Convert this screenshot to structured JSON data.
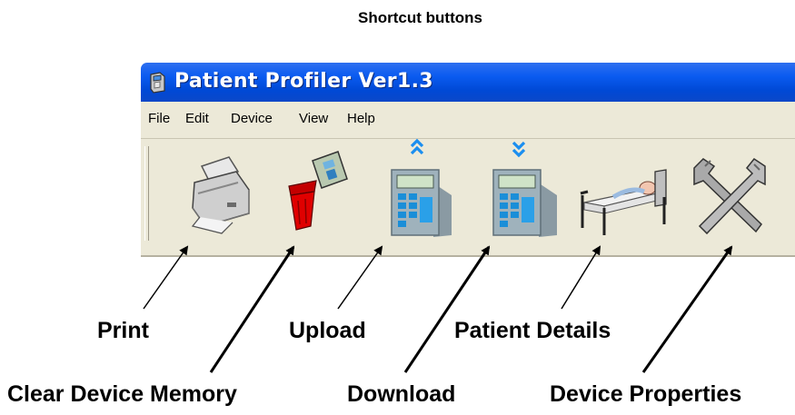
{
  "heading": "Shortcut buttons",
  "window": {
    "title": "Patient Profiler Ver1.3",
    "title_bar_color": "#0a5bf0"
  },
  "menu": {
    "items": [
      "File",
      "Edit",
      "Device",
      "View",
      "Help"
    ]
  },
  "toolbar": {
    "buttons": [
      {
        "name": "Print",
        "icon": "printer-icon"
      },
      {
        "name": "Clear Device Memory",
        "icon": "trash-memory-icon"
      },
      {
        "name": "Upload",
        "icon": "device-upload-icon"
      },
      {
        "name": "Download",
        "icon": "device-download-icon"
      },
      {
        "name": "Patient Details",
        "icon": "patient-bed-icon"
      },
      {
        "name": "Device Properties",
        "icon": "wrench-tools-icon"
      }
    ]
  },
  "callouts": {
    "print": "Print",
    "clear_memory": "Clear Device Memory",
    "upload": "Upload",
    "download": "Download",
    "patient_details": "Patient Details",
    "device_properties": "Device Properties"
  }
}
